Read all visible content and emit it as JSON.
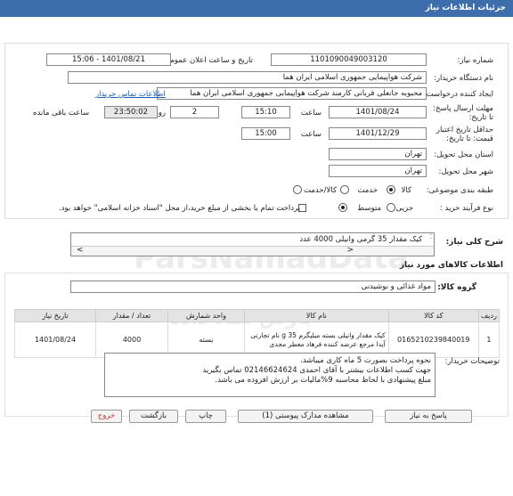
{
  "header": {
    "title": "جزئیات اطلاعات نیاز"
  },
  "form": {
    "need_number_label": "شماره نیاز:",
    "need_number": "1101090049003120",
    "announce_label": "تاریخ و ساعت اعلان عمومی:",
    "announce_value": "1401/08/21 - 15:06",
    "buyer_label": "نام دستگاه خریدار:",
    "buyer_value": "شرکت هواپیمایی جمهوری اسلامی ایران هما",
    "creator_label": "ایجاد کننده درخواست:",
    "creator_value": "محبوبه جانعلی قربانی کارمند شرکت هواپیمایی جمهوری اسلامی ایران هما",
    "contact_link": "اطلاعات تماس خریدار",
    "deadline_label": "مهلت ارسال پاسخ: تا تاریخ:",
    "deadline_date": "1401/08/24",
    "time_label": "ساعت",
    "deadline_time": "15:10",
    "days_value": "2",
    "days_label": "روز و",
    "remaining_time": "23:50:02",
    "remaining_label": "ساعت باقی مانده",
    "validity_label": "حداقل تاریخ اعتبار قیمت: تا تاریخ:",
    "validity_date": "1401/12/29",
    "validity_time_label": "ساعت",
    "validity_time": "15:00",
    "province_label": "استان محل تحویل:",
    "province_value": "تهران",
    "city_label": "شهر محل تحویل:",
    "city_value": "تهران",
    "category_label": "طبقه بندی موضوعی:",
    "cat_goods": "کالا",
    "cat_service": "خدمت",
    "cat_both": "کالا/خدمت",
    "process_label": "نوع فرآیند خرید :",
    "proc_partial": "جزیی",
    "proc_medium": "متوسط",
    "payment_note": "پرداخت تمام یا بخشی از مبلغ خرید،از محل \"اسناد خزانه اسلامی\" خواهد بود."
  },
  "summary": {
    "label": "شرح کلی نیاز:",
    "text": "کیک مقدار 35 گرمی وانیلی 4000 عدد"
  },
  "goods": {
    "section_title": "اطلاعات کالاهای مورد نیاز",
    "group_label": "گروه کالا:",
    "group_value": "مواد غذائی و نوشیدنی",
    "columns": [
      "ردیف",
      "کد کالا",
      "نام کالا",
      "واحد شمارش",
      "تعداد / مقدار",
      "تاریخ نیاز"
    ],
    "rows": [
      {
        "row": "1",
        "code": "0165210239840019",
        "name": "کیک مقدار وانیلی بسته میلیگرم 35 g نام تجارتی آیدا مرجع عرضه کننده فرهاد معطر مجدی",
        "unit": "بسته",
        "qty": "4000",
        "date": "1401/08/24"
      }
    ]
  },
  "notes": {
    "label": "توضیحات خریدار:",
    "lines": [
      "نحوه پرداخت بصورت 5 ماه کاری میباشد.",
      "جهت کسب اطلاعات بیشتر با آقای احمدی  02146624624 تماس بگیرید",
      "مبلغ پیشنهادی با لحاظ محاسبه 9%مالیات بر ارزش افزوده می باشد."
    ]
  },
  "buttons": {
    "reply": "پاسخ به نیاز",
    "docs": "مشاهده مدارک پیوستی (1)",
    "print": "چاپ",
    "back": "بازگشت",
    "exit": "خروج"
  },
  "colors": {
    "header": "#3d6eab",
    "exit": "#c0392b"
  }
}
